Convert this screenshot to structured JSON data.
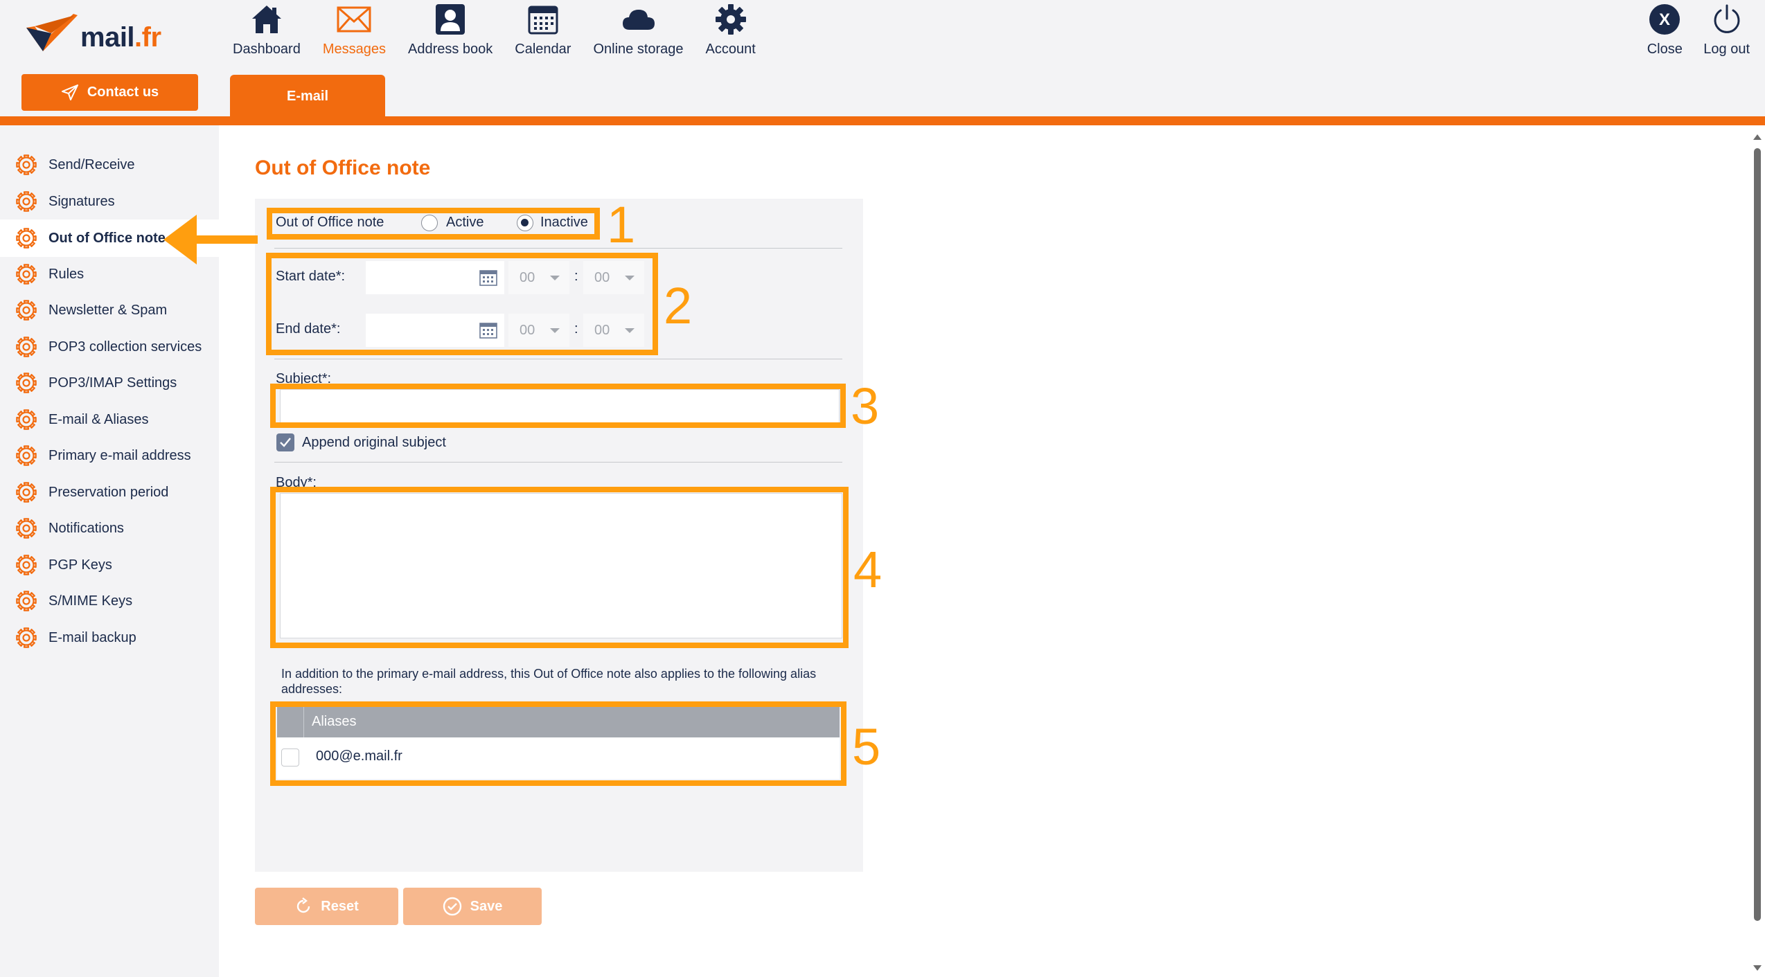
{
  "brand": {
    "logo_name": "mail",
    "logo_tld": ".fr"
  },
  "header": {
    "contact_label": "Contact us",
    "nav": [
      {
        "label": "Dashboard",
        "icon": "home-icon"
      },
      {
        "label": "Messages",
        "icon": "envelope-icon",
        "active": true
      },
      {
        "label": "Address book",
        "icon": "contact-card-icon"
      },
      {
        "label": "Calendar",
        "icon": "calendar-icon"
      },
      {
        "label": "Online storage",
        "icon": "cloud-icon"
      },
      {
        "label": "Account",
        "icon": "gear-icon"
      }
    ],
    "right_nav": [
      {
        "label": "Close",
        "icon": "close-icon"
      },
      {
        "label": "Log out",
        "icon": "power-icon"
      }
    ],
    "tab_label": "E-mail"
  },
  "sidebar": {
    "items": [
      {
        "label": "Send/Receive"
      },
      {
        "label": "Signatures"
      },
      {
        "label": "Out of Office note",
        "active": true
      },
      {
        "label": "Rules"
      },
      {
        "label": "Newsletter & Spam"
      },
      {
        "label": "POP3 collection services"
      },
      {
        "label": "POP3/IMAP Settings"
      },
      {
        "label": "E-mail & Aliases"
      },
      {
        "label": "Primary e-mail address"
      },
      {
        "label": "Preservation period"
      },
      {
        "label": "Notifications"
      },
      {
        "label": "PGP Keys"
      },
      {
        "label": "S/MIME Keys"
      },
      {
        "label": "E-mail backup"
      }
    ]
  },
  "form": {
    "title": "Out of Office note",
    "status_label": "Out of Office note",
    "status_options": [
      "Active",
      "Inactive"
    ],
    "status_selected": "Inactive",
    "start_label": "Start date*:",
    "end_label": "End date*:",
    "start_date": "",
    "end_date": "",
    "start_hour": "00",
    "start_minute": "00",
    "end_hour": "00",
    "end_minute": "00",
    "time_separator": ":",
    "subject_label": "Subject*:",
    "subject_value": "",
    "append_label": "Append original subject",
    "append_checked": true,
    "body_label": "Body*:",
    "body_value": "",
    "alias_note": "In addition to the primary e-mail address, this Out of Office note also applies to the following alias addresses:",
    "aliases_header": "Aliases",
    "aliases": [
      "000@e.mail.fr"
    ],
    "reset_label": "Reset",
    "save_label": "Save"
  },
  "annotations": [
    "1",
    "2",
    "3",
    "4",
    "5"
  ],
  "colors": {
    "accent": "#f26b0f",
    "navy": "#1b2a4a",
    "annotation": "#ff9e0f",
    "button_disabled": "#f7b88e"
  }
}
